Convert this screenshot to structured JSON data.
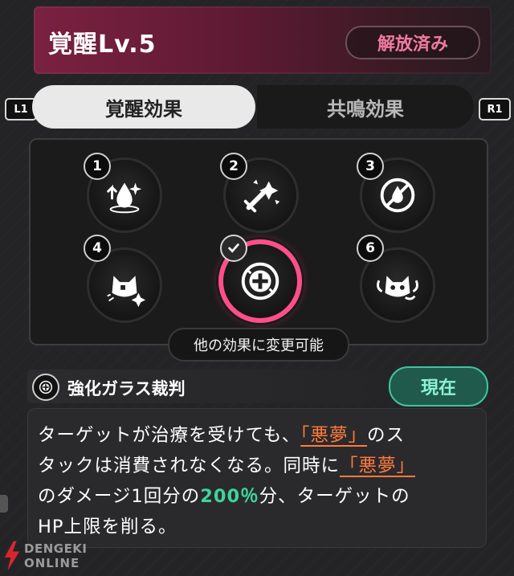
{
  "header": {
    "title": "覚醒Lv.5",
    "status": "解放済み"
  },
  "tabs": {
    "left_shoulder": "L1",
    "right_shoulder": "R1",
    "active": "覚醒効果",
    "inactive": "共鳴効果"
  },
  "nodes": [
    {
      "number": "1",
      "icon": "water-drop-upgrade-icon"
    },
    {
      "number": "2",
      "icon": "shattered-sword-icon"
    },
    {
      "number": "3",
      "icon": "water-drop-prohibit-icon"
    },
    {
      "number": "4",
      "icon": "cat-spark-icon"
    },
    {
      "number": "",
      "icon": "shield-cross-icon",
      "selected": true
    },
    {
      "number": "6",
      "icon": "cat-devil-icon"
    }
  ],
  "change_hint": "他の効果に変更可能",
  "effect": {
    "name": "強化ガラス裁判",
    "badge": "現在",
    "desc_line1_a": "ターゲットが治療を受けても、",
    "desc_line1_kw": "「悪夢」",
    "desc_line1_b": "のス",
    "desc_line2_a": "タックは消費されなくなる。同時に",
    "desc_line2_kw": "「悪夢」",
    "desc_line3_a": "のダメージ1回分の",
    "desc_line3_num": "200％",
    "desc_line3_b": "分、ターゲットの",
    "desc_line4": "HP上限を削る。"
  },
  "watermark": {
    "line1": "DENGEKI",
    "line2": "ONLINE"
  },
  "colors": {
    "accent": "#ff4f8a",
    "current": "#3fc4a1",
    "keyword": "#ff7a3d",
    "number": "#3fd49c"
  }
}
